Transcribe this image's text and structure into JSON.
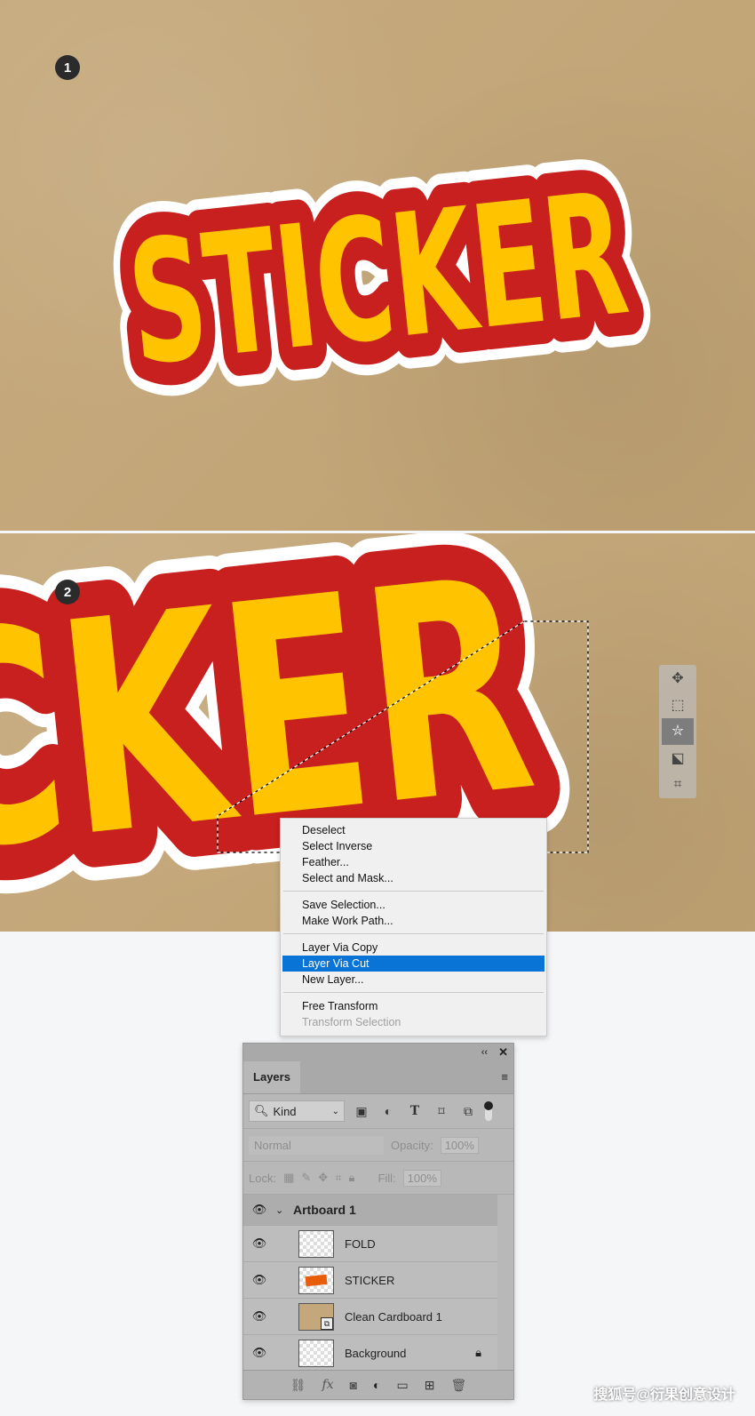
{
  "steps": {
    "step1": "1",
    "step2": "2"
  },
  "sticker": {
    "text": "STICKER",
    "zoom_text": "CKER",
    "colors": {
      "fill": "#ffc300",
      "outline": "#c8201e",
      "border": "#ffffff",
      "cardboard": "#c4a77a"
    }
  },
  "toolbar": {
    "tools": [
      {
        "name": "move-icon",
        "glyph": "✥"
      },
      {
        "name": "marquee-icon",
        "glyph": "⬚"
      },
      {
        "name": "polygonal-lasso-icon",
        "glyph": "⛦",
        "active": true
      },
      {
        "name": "object-select-icon",
        "glyph": "⬕"
      },
      {
        "name": "crop-icon",
        "glyph": "⌗"
      }
    ]
  },
  "context_menu": {
    "groups": [
      [
        "Deselect",
        "Select Inverse",
        "Feather...",
        "Select and Mask..."
      ],
      [
        "Save Selection...",
        "Make Work Path..."
      ],
      [
        "Layer Via Copy",
        "Layer Via Cut",
        "New Layer..."
      ],
      [
        "Free Transform",
        "Transform Selection"
      ]
    ],
    "highlighted": "Layer Via Cut",
    "disabled": "Transform Selection",
    "accent": "#0a74d6"
  },
  "layers_panel": {
    "collapse": "‹‹",
    "close": "✕",
    "tab": "Layers",
    "menu": "≡",
    "filter": {
      "kind": "Kind"
    },
    "blend_mode": "Normal",
    "opacity_label": "Opacity:",
    "opacity": "100%",
    "lock_label": "Lock:",
    "fill_label": "Fill:",
    "fill": "100%",
    "artboard": "Artboard 1",
    "layers": [
      {
        "name": "FOLD"
      },
      {
        "name": "STICKER"
      },
      {
        "name": "Clean Cardboard 1"
      },
      {
        "name": "Background",
        "locked": true
      }
    ]
  },
  "watermark": "搜狐号@衍果创意设计"
}
